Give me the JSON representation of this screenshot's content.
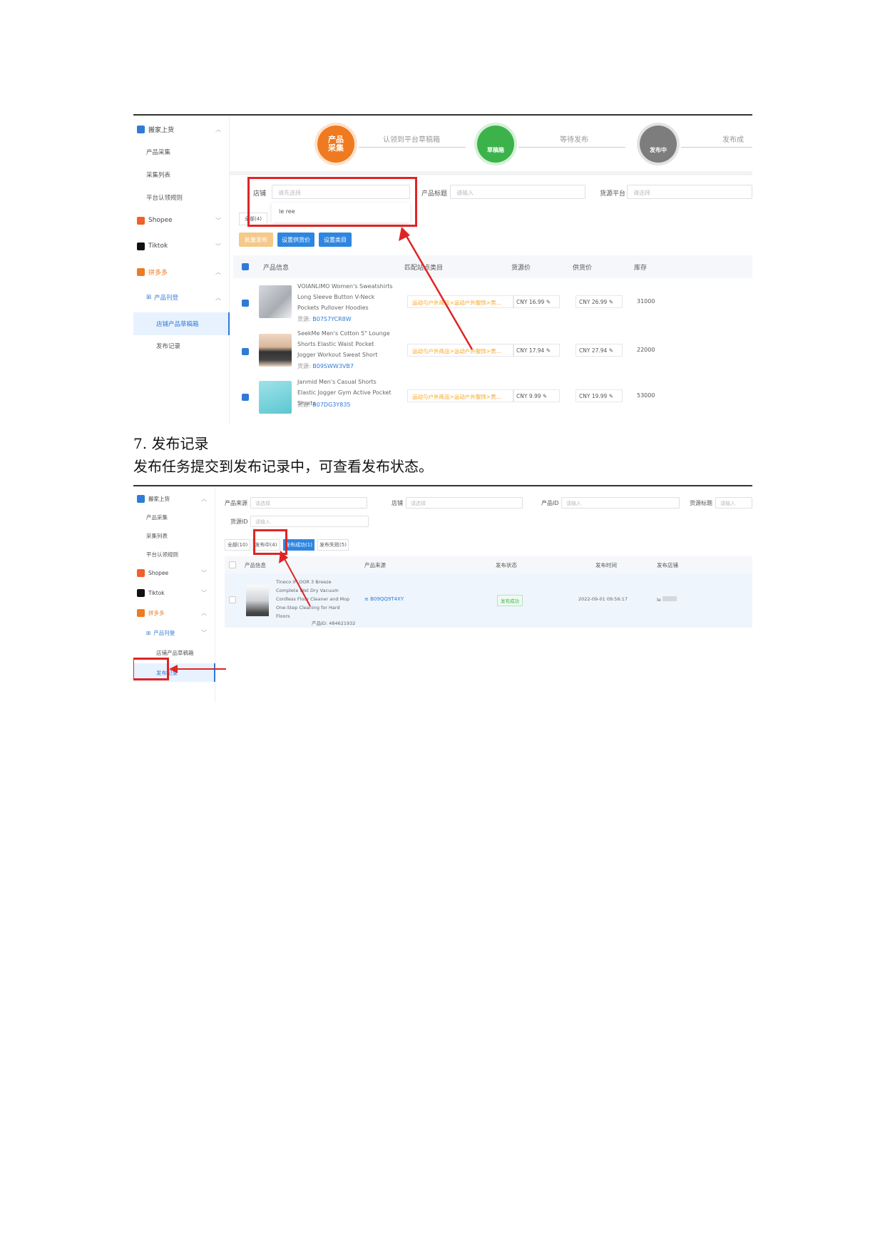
{
  "top_screenshot": {
    "sidebar": {
      "section": "搬家上货",
      "items": [
        "产品采集",
        "采集列表",
        "平台认领规则"
      ],
      "platforms": [
        "Shopee",
        "Tiktok",
        "拼多多"
      ],
      "sub_group": "产品刊登",
      "sub_items": [
        "店铺产品草稿箱",
        "发布记录"
      ]
    },
    "steps": {
      "step1": "产品采集",
      "label1": "认领到平台草稿箱",
      "step2": "草稿箱",
      "label2": "等待发布",
      "step3": "发布中",
      "label3": "发布成"
    },
    "filters": {
      "store_label": "店铺",
      "store_placeholder": "请先选择",
      "store_option": "le      ree",
      "title_label": "产品标题",
      "title_placeholder": "请输入",
      "source_label": "货源平台",
      "source_placeholder": "请选择"
    },
    "tab_all": "全部(4)",
    "buttons": [
      "批量发布",
      "设置供货价",
      "设置类目"
    ],
    "table_headers": [
      "产品信息",
      "匹配站点类目",
      "货源价",
      "供货价",
      "库存"
    ],
    "rows": [
      {
        "name": "VOIANLIMO Women's Sweatshirts Long Sleeve Button V-Neck Pockets Pullover Hoodies",
        "source_label": "货源:",
        "source_id": "B07S7YCR8W",
        "category": "运动与户外商品>运动户外服饰>男...",
        "src_currency": "CNY",
        "src_price": "16.99",
        "supply_currency": "CNY",
        "supply_price": "26.99",
        "stock": "31000"
      },
      {
        "name": "SeekMe Men's Cotton 5\" Lounge Shorts Elastic Waist Pocket Jogger Workout Sweat Short",
        "source_label": "货源:",
        "source_id": "B09SWW3VB7",
        "category": "运动与户外商品>运动户外服饰>男...",
        "src_currency": "CNY",
        "src_price": "17.94",
        "supply_currency": "CNY",
        "supply_price": "27.94",
        "stock": "22000"
      },
      {
        "name": "Janmid Men's Casual Shorts Elastic Jogger Gym Active Pocket Shorts",
        "source_label": "货源:",
        "source_id": "B07DG3Y835",
        "category": "运动与户外商品>运动户外服饰>男...",
        "src_currency": "CNY",
        "src_price": "9.99",
        "supply_currency": "CNY",
        "supply_price": "19.99",
        "stock": "53000"
      }
    ]
  },
  "heading": "7.  发布记录",
  "paragraph": "发布任务提交到发布记录中，可查看发布状态。",
  "bottom_screenshot": {
    "sidebar": {
      "section": "搬家上货",
      "items": [
        "产品采集",
        "采集列表",
        "平台认领规则"
      ],
      "platforms": [
        "Shopee",
        "Tiktok",
        "拼多多"
      ],
      "sub_group": "产品刊登",
      "sub_items": [
        "店铺产品草稿箱",
        "发布记录"
      ]
    },
    "filters": {
      "source_label": "产品来源",
      "source_placeholder": "请选择",
      "store_label": "店铺",
      "store_placeholder": "请选择",
      "product_id_label": "产品ID",
      "product_id_placeholder": "请输入",
      "title_label": "货源标题",
      "title_placeholder": "请输入",
      "source_id_label": "货源ID",
      "source_id_placeholder": "请输入"
    },
    "tabs": [
      "全部(10)",
      "发布中(4)",
      "发布成功(1)",
      "发布失败(5)"
    ],
    "table_headers": [
      "产品信息",
      "产品来源",
      "发布状态",
      "发布时间",
      "发布店铺"
    ],
    "row": {
      "name": "Tineco iFLOOR 3 Breeze Complete Wet Dry Vacuum Cordless Floor Cleaner and Mop One-Step Cleaning for Hard Floors",
      "product_id_label": "产品ID:",
      "product_id": "484621932",
      "source_id": "B09QQ9T4XY",
      "status": "发布成功",
      "time": "2022-09-01 09:56:17",
      "store": "le"
    }
  },
  "colors": {
    "orange": "#f07a1f",
    "green": "#3cb34a",
    "gray": "#7d7d7d",
    "blue": "#2f7bd6",
    "red": "#e02424"
  }
}
